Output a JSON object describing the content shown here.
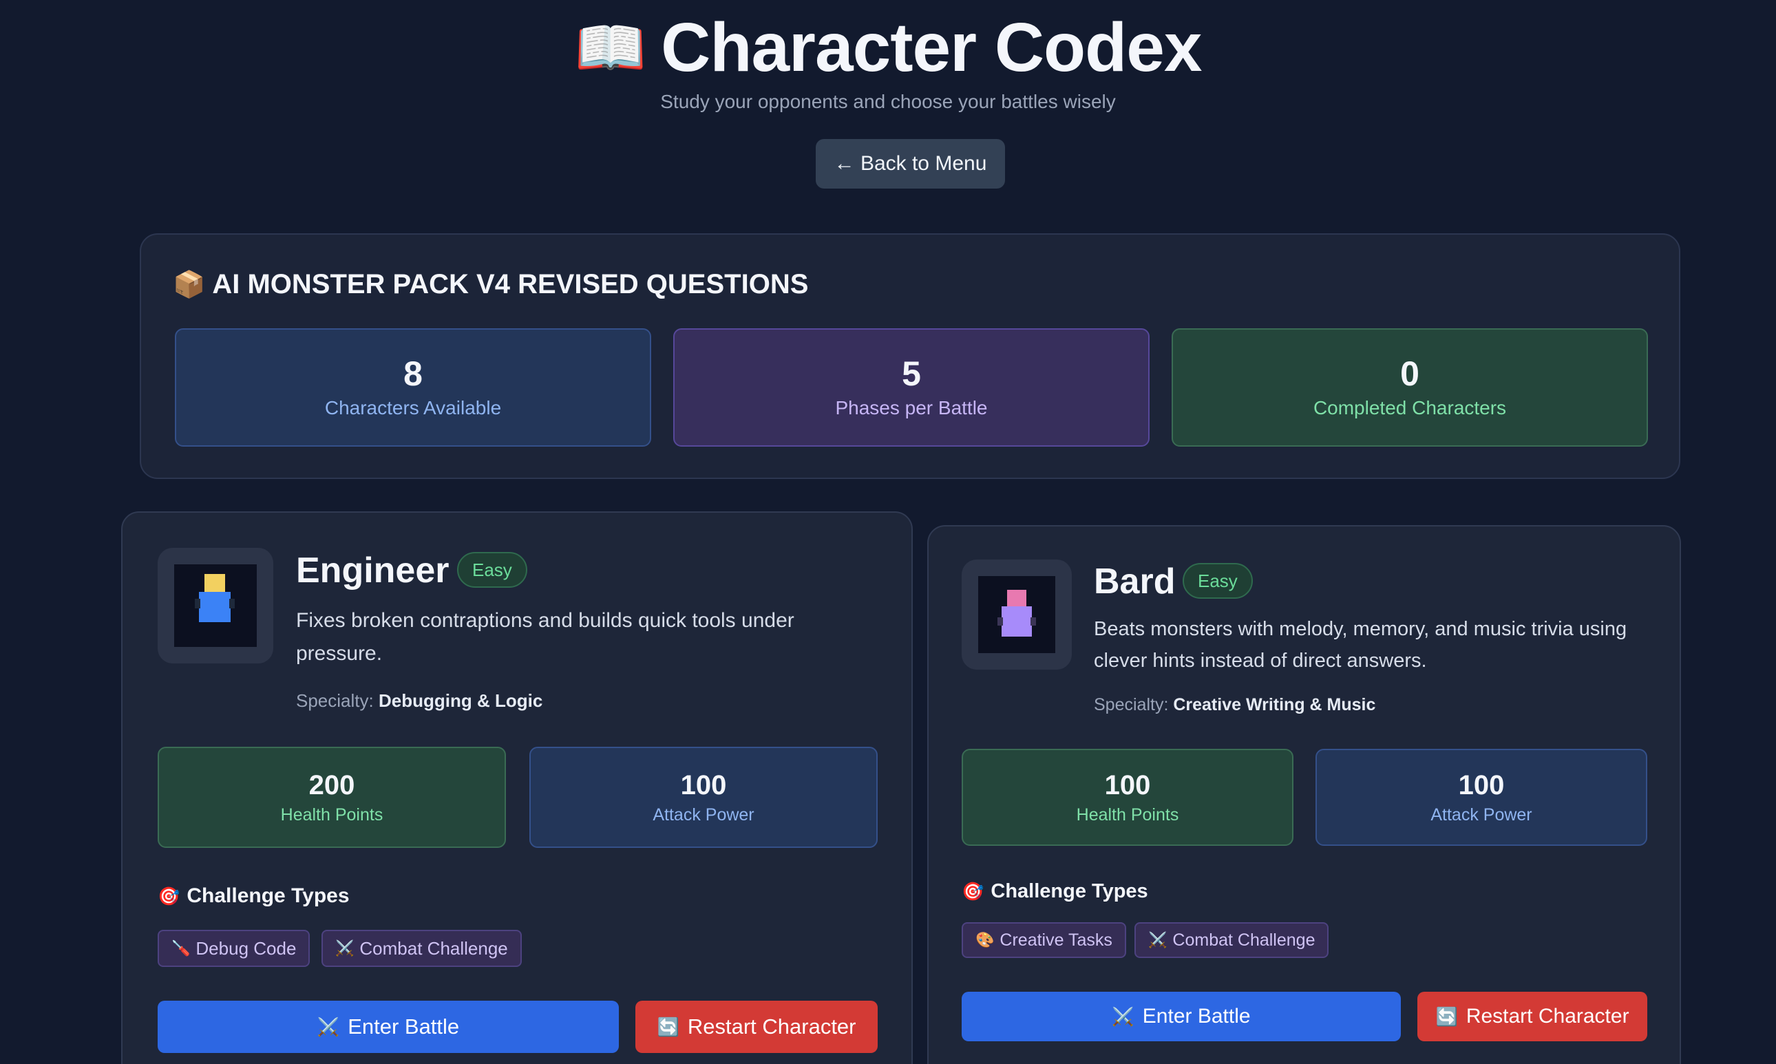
{
  "header": {
    "title_icon": "📖",
    "title": "Character Codex",
    "subtitle": "Study your opponents and choose your battles wisely",
    "back_label": "← Back to Menu"
  },
  "pack": {
    "icon": "📦",
    "title": "AI MONSTER PACK V4 REVISED QUESTIONS",
    "stats": [
      {
        "value": "8",
        "label": "Characters Available"
      },
      {
        "value": "5",
        "label": "Phases per Battle"
      },
      {
        "value": "0",
        "label": "Completed Characters"
      }
    ]
  },
  "characters": [
    {
      "name": "Engineer",
      "difficulty": "Easy",
      "description": "Fixes broken contraptions and builds quick tools under pressure.",
      "specialty_label": "Specialty:",
      "specialty": "Debugging & Logic",
      "hp_value": "200",
      "hp_label": "Health Points",
      "ap_value": "100",
      "ap_label": "Attack Power",
      "challenge_icon": "🎯",
      "challenge_title": "Challenge Types",
      "tags": [
        {
          "icon": "🪛",
          "label": "Debug Code"
        },
        {
          "icon": "⚔️",
          "label": "Combat Challenge"
        }
      ],
      "enter_icon": "⚔️",
      "enter_label": "Enter Battle",
      "restart_icon": "🔄",
      "restart_label": "Restart Character",
      "sprite_colors": {
        "head": "#f2d060",
        "body": "#3b82f6"
      }
    },
    {
      "name": "Bard",
      "difficulty": "Easy",
      "description": "Beats monsters with melody, memory, and music trivia using clever hints instead of direct answers.",
      "specialty_label": "Specialty:",
      "specialty": "Creative Writing & Music",
      "hp_value": "100",
      "hp_label": "Health Points",
      "ap_value": "100",
      "ap_label": "Attack Power",
      "challenge_icon": "🎯",
      "challenge_title": "Challenge Types",
      "tags": [
        {
          "icon": "🎨",
          "label": "Creative Tasks"
        },
        {
          "icon": "⚔️",
          "label": "Combat Challenge"
        }
      ],
      "enter_icon": "⚔️",
      "enter_label": "Enter Battle",
      "restart_icon": "🔄",
      "restart_label": "Restart Character",
      "sprite_colors": {
        "head": "#e879b0",
        "body": "#a78bfa"
      }
    }
  ]
}
